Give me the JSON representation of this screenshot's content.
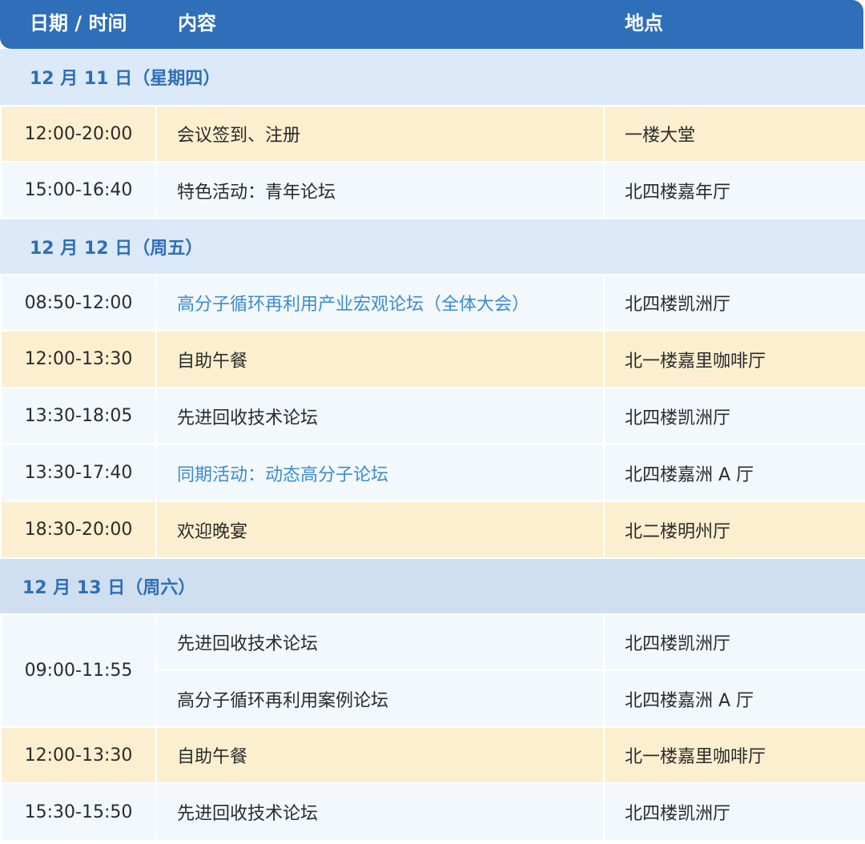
{
  "header": {
    "col_time": "日期 / 时间",
    "col_content": "内容",
    "col_location": "地点"
  },
  "days": [
    {
      "date": "12 月 11 日（星期四）",
      "rows": [
        {
          "time": "12:00-20:00",
          "content": "会议签到、注册",
          "location": "一楼大堂"
        },
        {
          "time": "15:00-16:40",
          "content": "特色活动：青年论坛",
          "location": "北四楼嘉年厅"
        }
      ]
    },
    {
      "date": "12 月 12 日（周五）",
      "rows": [
        {
          "time": "08:50-12:00",
          "content": "高分子循环再利用产业宏观论坛（全体大会）",
          "location": "北四楼凯洲厅",
          "link": true
        },
        {
          "time": "12:00-13:30",
          "content": "自助午餐",
          "location": "北一楼嘉里咖啡厅"
        },
        {
          "time": "13:30-18:05",
          "content": "先进回收技术论坛",
          "location": "北四楼凯洲厅"
        },
        {
          "time": "13:30-17:40",
          "content": "同期活动：动态高分子论坛",
          "location": "北四楼嘉洲 A 厅",
          "link": true
        },
        {
          "time": "18:30-20:00",
          "content": "欢迎晚宴",
          "location": "北二楼明州厅"
        }
      ]
    },
    {
      "date": "12 月 13 日（周六）",
      "rows": [
        {
          "time": "09:00-11:55",
          "content": "先进回收技术论坛",
          "location": "北四楼凯洲厅"
        },
        {
          "time": "",
          "content": "高分子循环再利用案例论坛",
          "location": "北四楼嘉洲 A 厅"
        },
        {
          "time": "12:00-13:30",
          "content": "自助午餐",
          "location": "北一楼嘉里咖啡厅"
        },
        {
          "time": "15:30-15:50",
          "content": "先进回收技术论坛",
          "location": "北四楼凯洲厅"
        }
      ]
    }
  ]
}
